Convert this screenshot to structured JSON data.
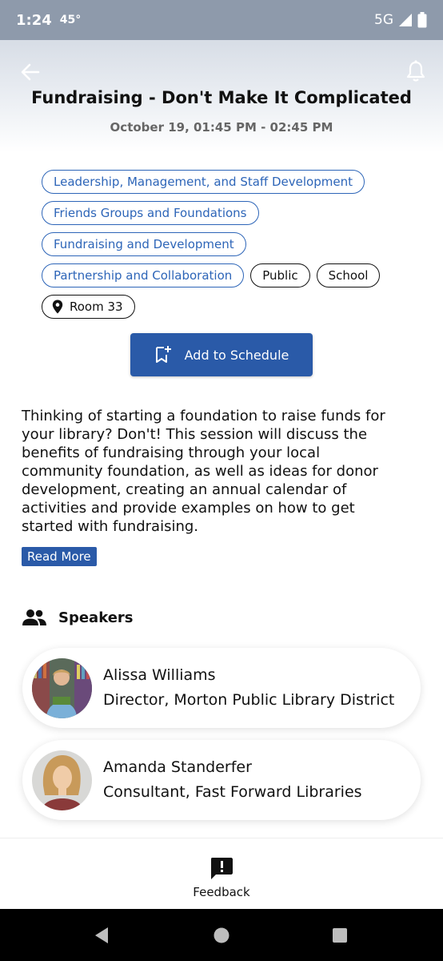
{
  "status_bar": {
    "time": "1:24",
    "temperature": "45°",
    "network": "5G"
  },
  "header": {
    "title": "Fundraising - Don't Make It Complicated",
    "datetime": "October 19, 01:45 PM -  02:45 PM"
  },
  "tags": {
    "t0": "Leadership, Management, and Staff Development",
    "t1": "Friends Groups and Foundations",
    "t2": "Fundraising and Development",
    "t3": "Partnership and Collaboration",
    "t4": "Public",
    "t5": "School",
    "room": "Room 33"
  },
  "actions": {
    "add_to_schedule": "Add to Schedule"
  },
  "description": {
    "text": "Thinking of starting a foundation to raise funds for your library? Don't! This session will discuss the benefits of fundraising through your local community foundation, as well as ideas for donor development, creating an annual calendar of activities and provide examples on how to get started with fundraising.",
    "read_more": "Read More"
  },
  "speakers": {
    "heading": "Speakers",
    "s0": {
      "name": "Alissa Williams",
      "role": "Director, Morton Public Library District"
    },
    "s1": {
      "name": "Amanda Standerfer",
      "role": "Consultant, Fast Forward Libraries"
    }
  },
  "bottom_nav": {
    "feedback": "Feedback"
  },
  "colors": {
    "accent": "#2a5aa8",
    "tag_blue": "#2d65b8",
    "status_bar": "#8e9aab"
  },
  "icons": [
    "back-arrow-icon",
    "bell-icon",
    "location-pin-icon",
    "bookmark-add-icon",
    "people-icon",
    "feedback-icon",
    "signal-icon",
    "battery-icon",
    "nav-back-icon",
    "nav-home-icon",
    "nav-recents-icon"
  ]
}
